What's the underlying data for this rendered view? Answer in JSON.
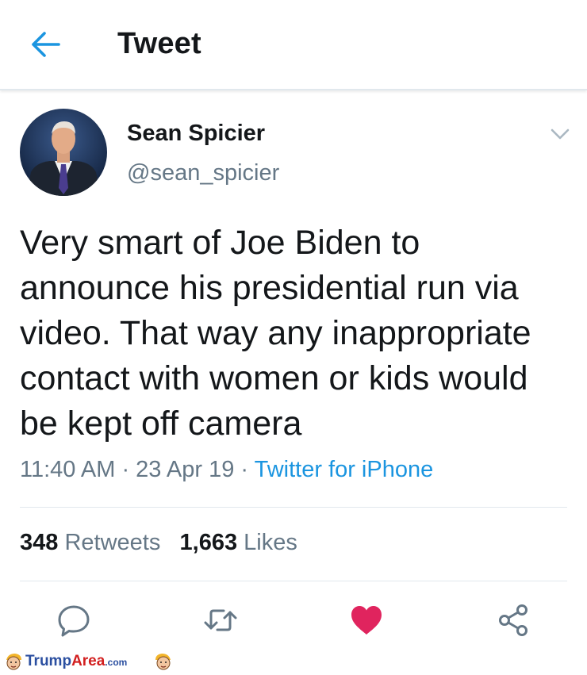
{
  "header": {
    "title": "Tweet",
    "back_icon": "arrow-left-icon"
  },
  "tweet": {
    "author_name": "Sean Spicier",
    "author_handle": "@sean_spicier",
    "text": "Very smart of Joe Biden to announce his presidential run via video. That way any inappropriate contact with women or kids would be kept off camera",
    "time": "11:40 AM",
    "separator": " · ",
    "date": "23 Apr 19",
    "source": "Twitter for iPhone",
    "retweet_count": "348",
    "retweet_label": "Retweets",
    "like_count": "1,663",
    "like_label": "Likes"
  },
  "actions": {
    "reply_icon": "reply-icon",
    "retweet_icon": "retweet-icon",
    "like_icon": "heart-icon",
    "share_icon": "share-icon",
    "liked": true
  },
  "watermark": {
    "brand": "Trump",
    "brand_accent": "Area",
    "suffix": ".com"
  },
  "colors": {
    "accent": "#1b95e0",
    "like": "#e0245e",
    "secondary_text": "#657786",
    "watermark_blue": "#2b4fa0",
    "watermark_red": "#d21f1f"
  }
}
